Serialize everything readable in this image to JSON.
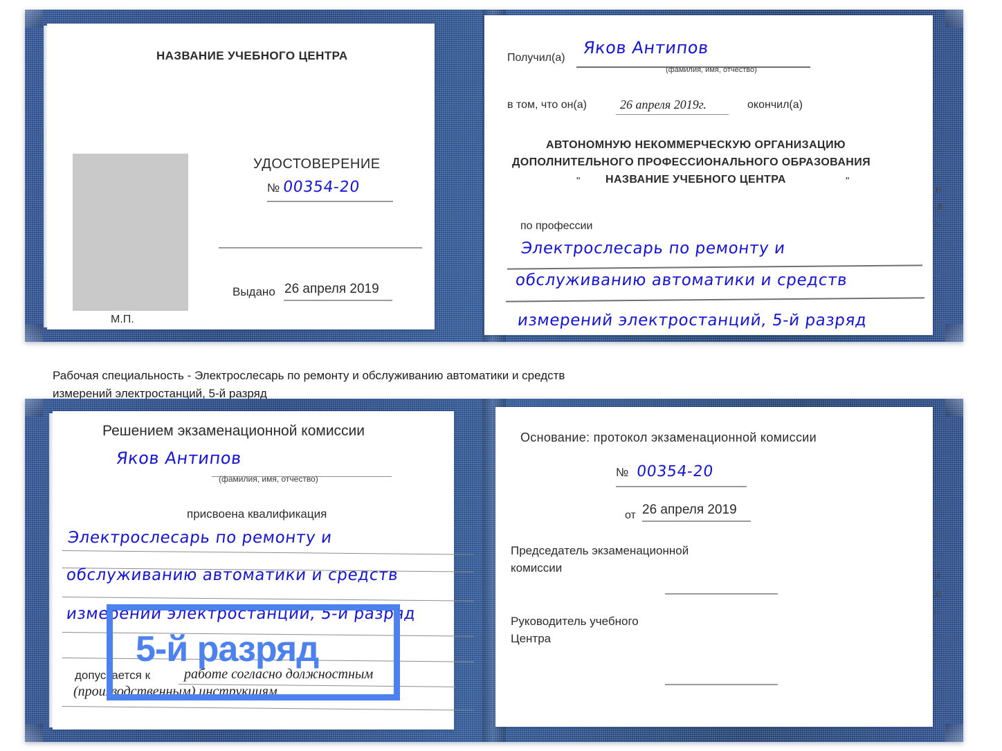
{
  "document": {
    "type": "certificate-scan",
    "language": "ru"
  },
  "colors": {
    "cover_blue": "#274a85",
    "handwriting_blue": "#1616d2",
    "highlight_blue": "#4d82ee",
    "rule_gray": "#9b9b9b",
    "photo_placeholder_gray": "#c9c9c9"
  },
  "certificate_top": {
    "left_page": {
      "header": "НАЗВАНИЕ УЧЕБНОГО ЦЕНТРА",
      "doc_title": "УДОСТОВЕРЕНИЕ",
      "number_symbol": "№",
      "number_value": "00354-20",
      "issued_label": "Выдано",
      "issued_value": "26 апреля 2019",
      "stamp_label": "М.П.",
      "photo_alt": "photo-placeholder"
    },
    "right_page": {
      "received_label": "Получил(а)",
      "received_value": "Яков Антипов",
      "fio_hint": "(фамилия, имя, отчество)",
      "in_that_label": "в том, что он(а)",
      "date_value": "26 апреля 2019г.",
      "finished_label": "окончил(а)",
      "org_line1": "АВТОНОМНУЮ НЕКОММЕРЧЕСКУЮ ОРГАНИЗАЦИЮ",
      "org_line2": "ДОПОЛНИТЕЛЬНОГО ПРОФЕССИОНАЛЬНОГО ОБРАЗОВАНИЯ",
      "org_quote_open": "\"",
      "org_line3": "НАЗВАНИЕ УЧЕБНОГО ЦЕНТРА",
      "org_quote_close": "\"",
      "profession_label": "по профессии",
      "profession_line1": "Электрослесарь по ремонту и",
      "profession_line2": "обслуживанию автоматики и средств",
      "profession_line3": "измерений электростанций, 5-й разряд",
      "edge_fragments": [
        "–",
        "–",
        "–",
        "и",
        ",а",
        "‹-",
        "–",
        "–",
        "–",
        "–"
      ]
    }
  },
  "caption": {
    "line1": "Рабочая специальность - Электрослесарь по ремонту и обслуживанию автоматики и средств",
    "line2": "измерений электростанций, 5-й разряд"
  },
  "certificate_bottom": {
    "left_page": {
      "header": "Решением экзаменационной комиссии",
      "name_value": "Яков Антипов",
      "fio_hint": "(фамилия, имя, отчество)",
      "qualification_label": "присвоена квалификация",
      "qualification_line1": "Электрослесарь по ремонту и",
      "qualification_line2": "обслуживанию автоматики и средств",
      "qualification_line3": "измерений электростанций, 5-й разряд",
      "allowed_label": "допускается к",
      "allowed_value1": "работе согласно должностным",
      "allowed_value2": "(производственным) инструкциям"
    },
    "right_page": {
      "basis_label": "Основание: протокол экзаменационной комиссии",
      "number_symbol": "№",
      "number_value": "00354-20",
      "from_label": "от",
      "from_value": "26 апреля 2019",
      "chairman_line1": "Председатель экзаменационной",
      "chairman_line2": "комиссии",
      "head_line1": "Руководитель учебного",
      "head_line2": "Центра",
      "edge_fragments": [
        "–",
        "–",
        "–",
        "и",
        ",а",
        "‹-",
        "–",
        "–",
        "–",
        "–"
      ]
    }
  },
  "annotation": {
    "highlight_text": "5-й разряд"
  }
}
